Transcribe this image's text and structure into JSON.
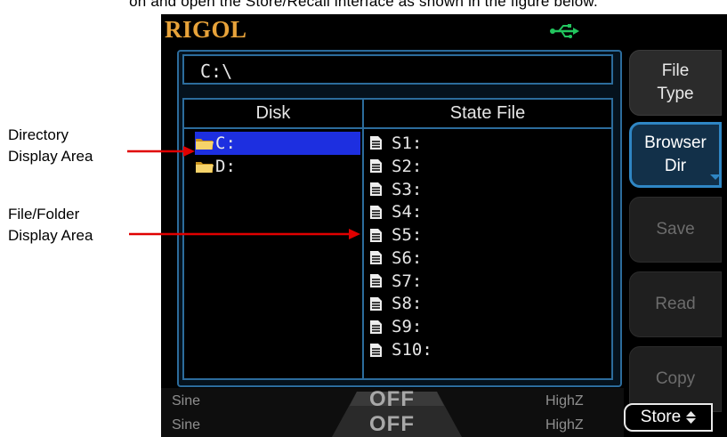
{
  "page_caption": "on and open the Store/Recall interface as shown in the figure below.",
  "annotations": {
    "directory": [
      "Directory",
      "Display Area"
    ],
    "file_folder": [
      "File/Folder",
      "Display Area"
    ]
  },
  "instrument": {
    "logo": "RIGOL",
    "path": "C:\\",
    "columns": {
      "disk": "Disk",
      "state_file": "State File"
    },
    "disks": [
      {
        "label": "C:",
        "selected": true
      },
      {
        "label": "D:",
        "selected": false
      }
    ],
    "files": [
      "S1:",
      "S2:",
      "S3:",
      "S4:",
      "S5:",
      "S6:",
      "S7:",
      "S8:",
      "S9:",
      "S10:"
    ],
    "softkeys": [
      {
        "line1": "File",
        "line2": "Type",
        "state": "active"
      },
      {
        "line1": "Browser",
        "line2": "Dir",
        "state": "selected"
      },
      {
        "line1": "Save",
        "line2": "",
        "state": "disabled"
      },
      {
        "line1": "Read",
        "line2": "",
        "state": "disabled"
      },
      {
        "line1": "Copy",
        "line2": "",
        "state": "disabled"
      }
    ],
    "store_key": {
      "label": "Store",
      "arrows": "⬘"
    },
    "channels": {
      "ch1": {
        "wave": "Sine",
        "output": "OFF",
        "load": "HighZ"
      },
      "ch2": {
        "wave": "Sine",
        "output": "OFF",
        "load": "HighZ"
      }
    },
    "colors": {
      "logo": "#e8a33a",
      "border": "#2c6c9c",
      "selection": "#1d2fe0",
      "usb": "#22c55e",
      "arrow": "#e00000"
    }
  }
}
